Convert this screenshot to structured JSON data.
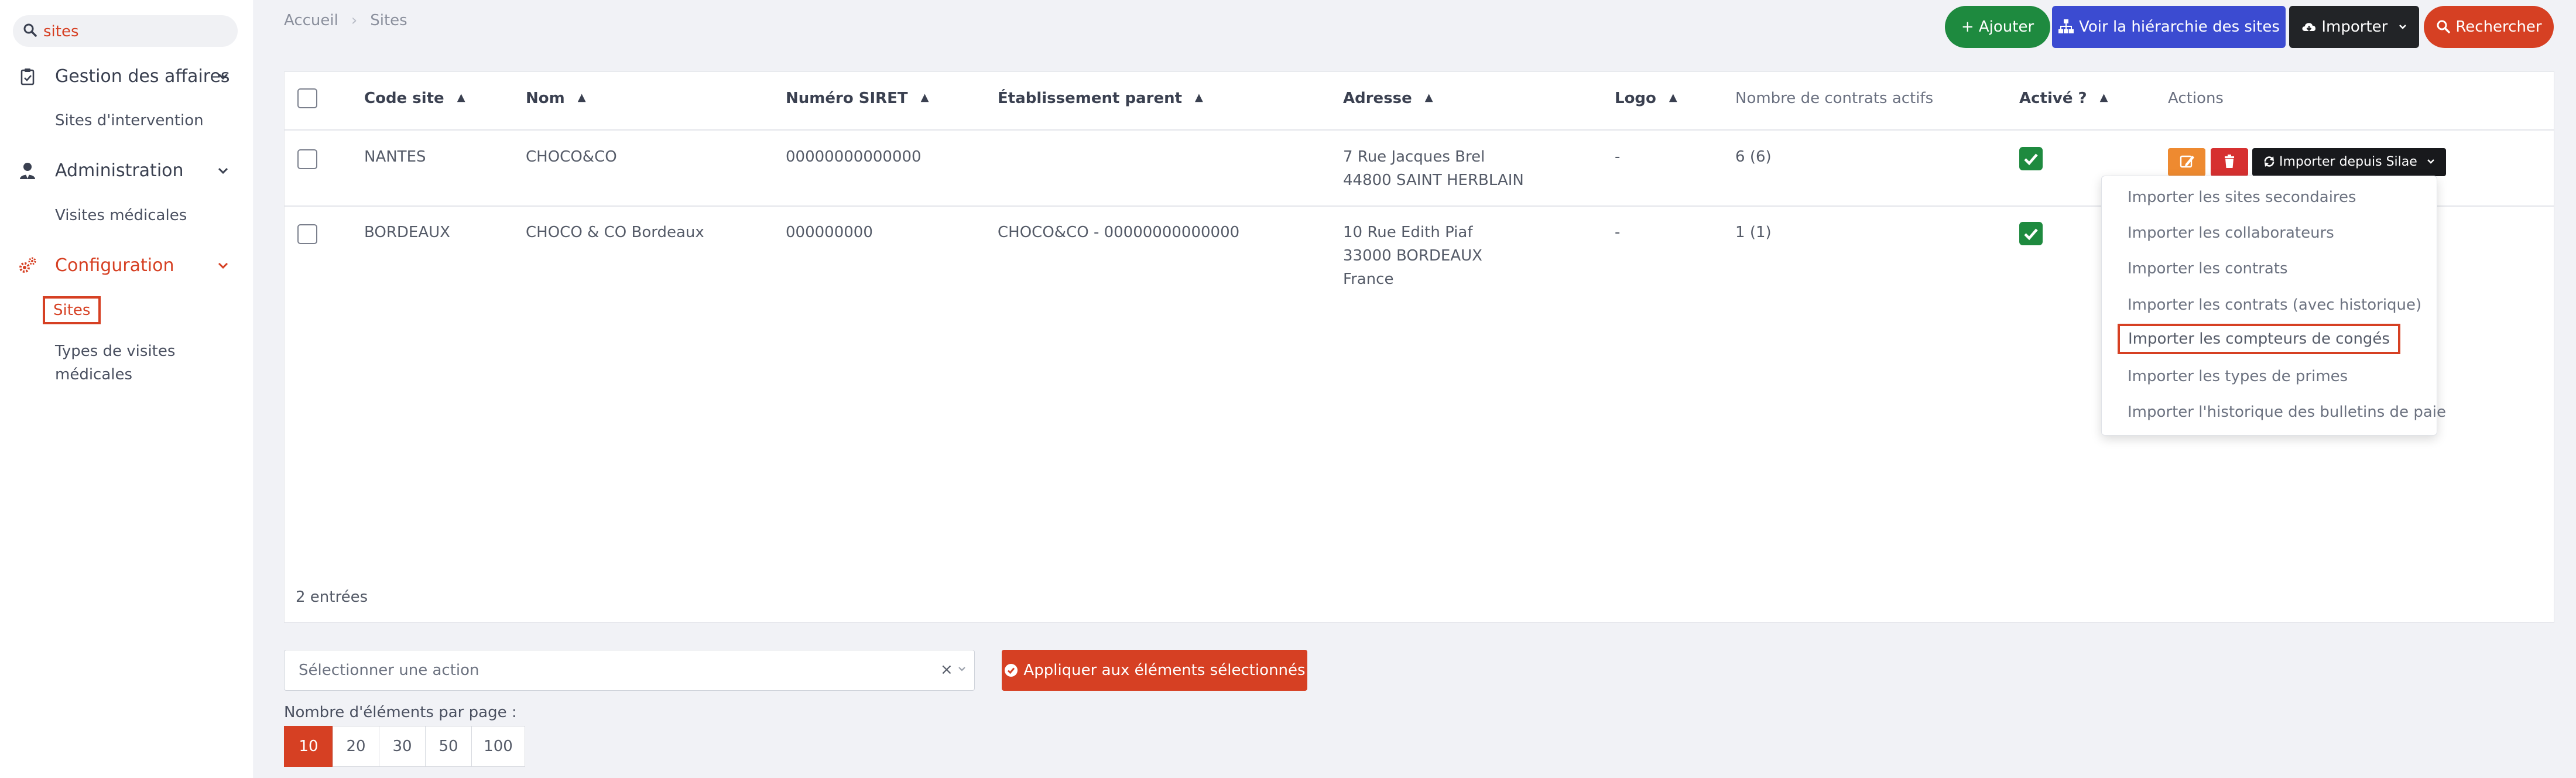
{
  "sidebar": {
    "search_value": "sites",
    "groups": [
      {
        "label": "Gestion des affaires",
        "icon": "clipboard-icon",
        "items": [
          "Sites d'intervention"
        ]
      },
      {
        "label": "Administration",
        "icon": "user-tie-icon",
        "items": [
          "Visites médicales"
        ]
      },
      {
        "label": "Configuration",
        "icon": "gears-icon",
        "items": [
          "Sites",
          "Types de visites",
          "médicales"
        ]
      }
    ]
  },
  "breadcrumb": {
    "home": "Accueil",
    "sep": "›",
    "current": "Sites"
  },
  "toolbar": {
    "add": "+ Ajouter",
    "hierarchy": "Voir la hiérarchie des sites",
    "import": "Importer",
    "search": "Rechercher"
  },
  "table": {
    "headers": [
      "Code site",
      "Nom",
      "Numéro SIRET",
      "Établissement parent",
      "Adresse",
      "Logo",
      "Nombre de contrats actifs",
      "Activé ?",
      "Actions"
    ],
    "sort_glyph": "▲",
    "rows": [
      {
        "code": "NANTES",
        "nom": "CHOCO&CO",
        "siret": "00000000000000",
        "parent": "",
        "adresse": [
          "7 Rue Jacques Brel",
          "44800 SAINT HERBLAIN"
        ],
        "logo": "-",
        "contrats": "6",
        "contrats_total": "(6)",
        "active": true
      },
      {
        "code": "BORDEAUX",
        "nom": "CHOCO & CO Bordeaux",
        "siret": "000000000",
        "parent": "CHOCO&CO - 00000000000000",
        "adresse": [
          "10 Rue Edith Piaf",
          "33000 BORDEAUX",
          "France"
        ],
        "logo": "-",
        "contrats": "1",
        "contrats_total": "(1)",
        "active": true
      }
    ],
    "action_import": "Importer depuis Silae",
    "entries": "2 entrées"
  },
  "import_menu": [
    "Importer les sites secondaires",
    "Importer les collaborateurs",
    "Importer les contrats",
    "Importer les contrats (avec historique)",
    "Importer les compteurs de congés",
    "Importer les types de primes",
    "Importer l'historique des bulletins de paie"
  ],
  "bulk": {
    "placeholder": "Sélectionner une action",
    "clear": "×",
    "apply": "Appliquer aux éléments sélectionnés"
  },
  "pagination": {
    "label": "Nombre d'éléments par page :",
    "options": [
      "10",
      "20",
      "30",
      "50",
      "100"
    ],
    "selected": "10"
  },
  "colors": {
    "accent": "#d64023",
    "success": "#1e8a3f",
    "primary": "#3b4bd1",
    "dark": "#222427"
  }
}
